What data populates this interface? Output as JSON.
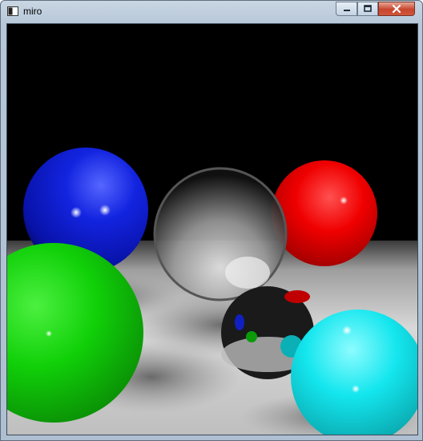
{
  "window": {
    "title": "miro",
    "controls": {
      "minimize_icon": "minimize-icon",
      "maximize_icon": "maximize-icon",
      "close_icon": "close-icon"
    }
  },
  "render": {
    "description_colors": {
      "blue_sphere": "#0a1bd6",
      "red_sphere": "#e00000",
      "green_sphere": "#12c80a",
      "cyan_sphere": "#10e0e6",
      "floor": "#d9d9d9",
      "background": "#000000"
    }
  }
}
